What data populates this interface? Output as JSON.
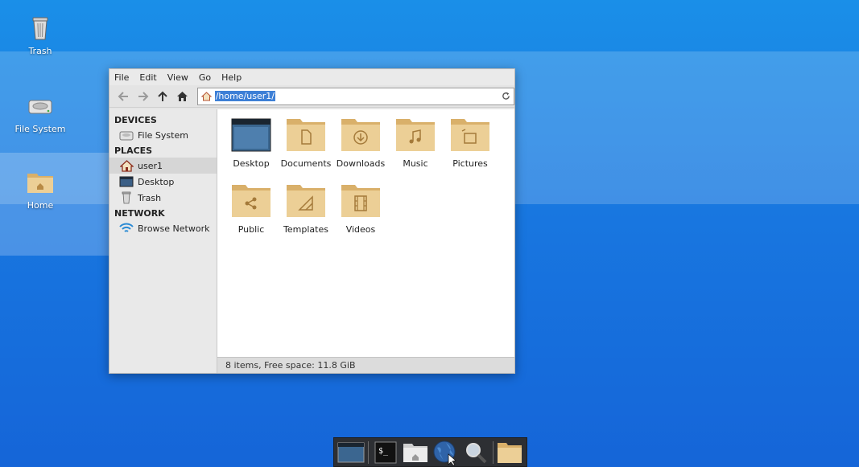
{
  "desktop": {
    "icons": [
      {
        "label": "Trash"
      },
      {
        "label": "File System"
      },
      {
        "label": "Home"
      }
    ]
  },
  "window": {
    "menu": [
      "File",
      "Edit",
      "View",
      "Go",
      "Help"
    ],
    "address": "/home/user1/",
    "sidebar": {
      "devices_heading": "DEVICES",
      "places_heading": "PLACES",
      "network_heading": "NETWORK",
      "devices": [
        {
          "label": "File System"
        }
      ],
      "places": [
        {
          "label": "user1"
        },
        {
          "label": "Desktop"
        },
        {
          "label": "Trash"
        }
      ],
      "network": [
        {
          "label": "Browse Network"
        }
      ]
    },
    "files": [
      {
        "label": "Desktop",
        "icon": "desktop-folder-icon"
      },
      {
        "label": "Documents",
        "icon": "documents-folder-icon"
      },
      {
        "label": "Downloads",
        "icon": "downloads-folder-icon"
      },
      {
        "label": "Music",
        "icon": "music-folder-icon"
      },
      {
        "label": "Pictures",
        "icon": "pictures-folder-icon"
      },
      {
        "label": "Public",
        "icon": "public-folder-icon"
      },
      {
        "label": "Templates",
        "icon": "templates-folder-icon"
      },
      {
        "label": "Videos",
        "icon": "videos-folder-icon"
      }
    ],
    "status": "8 items, Free space: 11.8 GiB"
  },
  "colors": {
    "folder": "#e9c98f",
    "folder_dark": "#d9b06a",
    "selection": "#3d7fd6"
  }
}
